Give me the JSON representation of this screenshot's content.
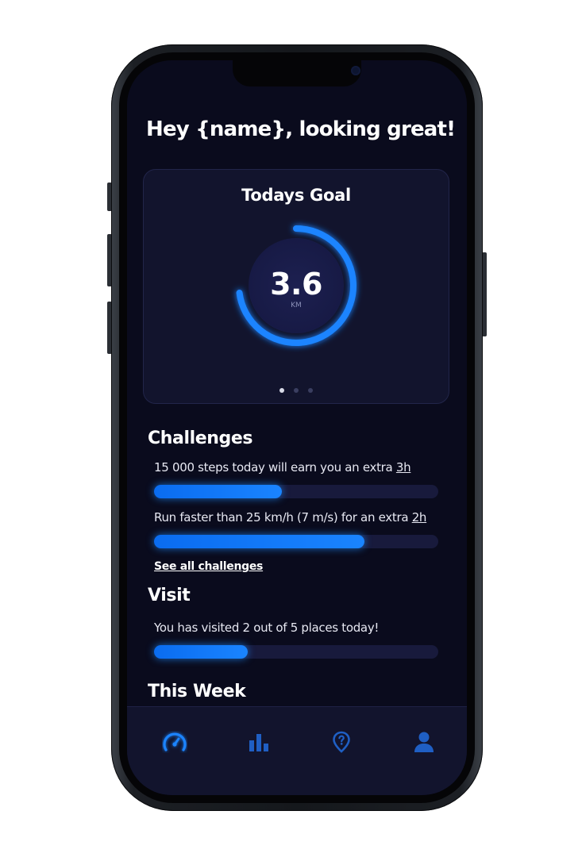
{
  "header": {
    "greeting": "Hey {name}, looking great!"
  },
  "goal_card": {
    "title": "Todays Goal",
    "value": "3.6",
    "unit": "KM",
    "progress": 0.73,
    "page_dots": {
      "count": 3,
      "active_index": 0
    }
  },
  "challenges": {
    "title": "Challenges",
    "items": [
      {
        "text": "15 000 steps today will earn you an extra ",
        "reward": "3h",
        "progress": 0.45
      },
      {
        "text": "Run faster than 25 km/h (7 m/s) for an extra ",
        "reward": "2h",
        "progress": 0.74
      }
    ],
    "see_all_label": "See all challenges"
  },
  "visit": {
    "title": "Visit",
    "text": "You has visited 2 out of 5 places today!",
    "progress": 0.33
  },
  "this_week": {
    "title": "This Week"
  },
  "tabbar": {
    "items": [
      {
        "icon": "speedometer-icon",
        "active": true
      },
      {
        "icon": "bar-chart-icon",
        "active": false
      },
      {
        "icon": "map-pin-question-icon",
        "active": false
      },
      {
        "icon": "user-icon",
        "active": false
      }
    ]
  },
  "colors": {
    "background": "#0a0b1d",
    "card": "#12142d",
    "accent": "#1a84ff",
    "track": "#181a3c",
    "inactive_icon": "#1f5fc4"
  }
}
